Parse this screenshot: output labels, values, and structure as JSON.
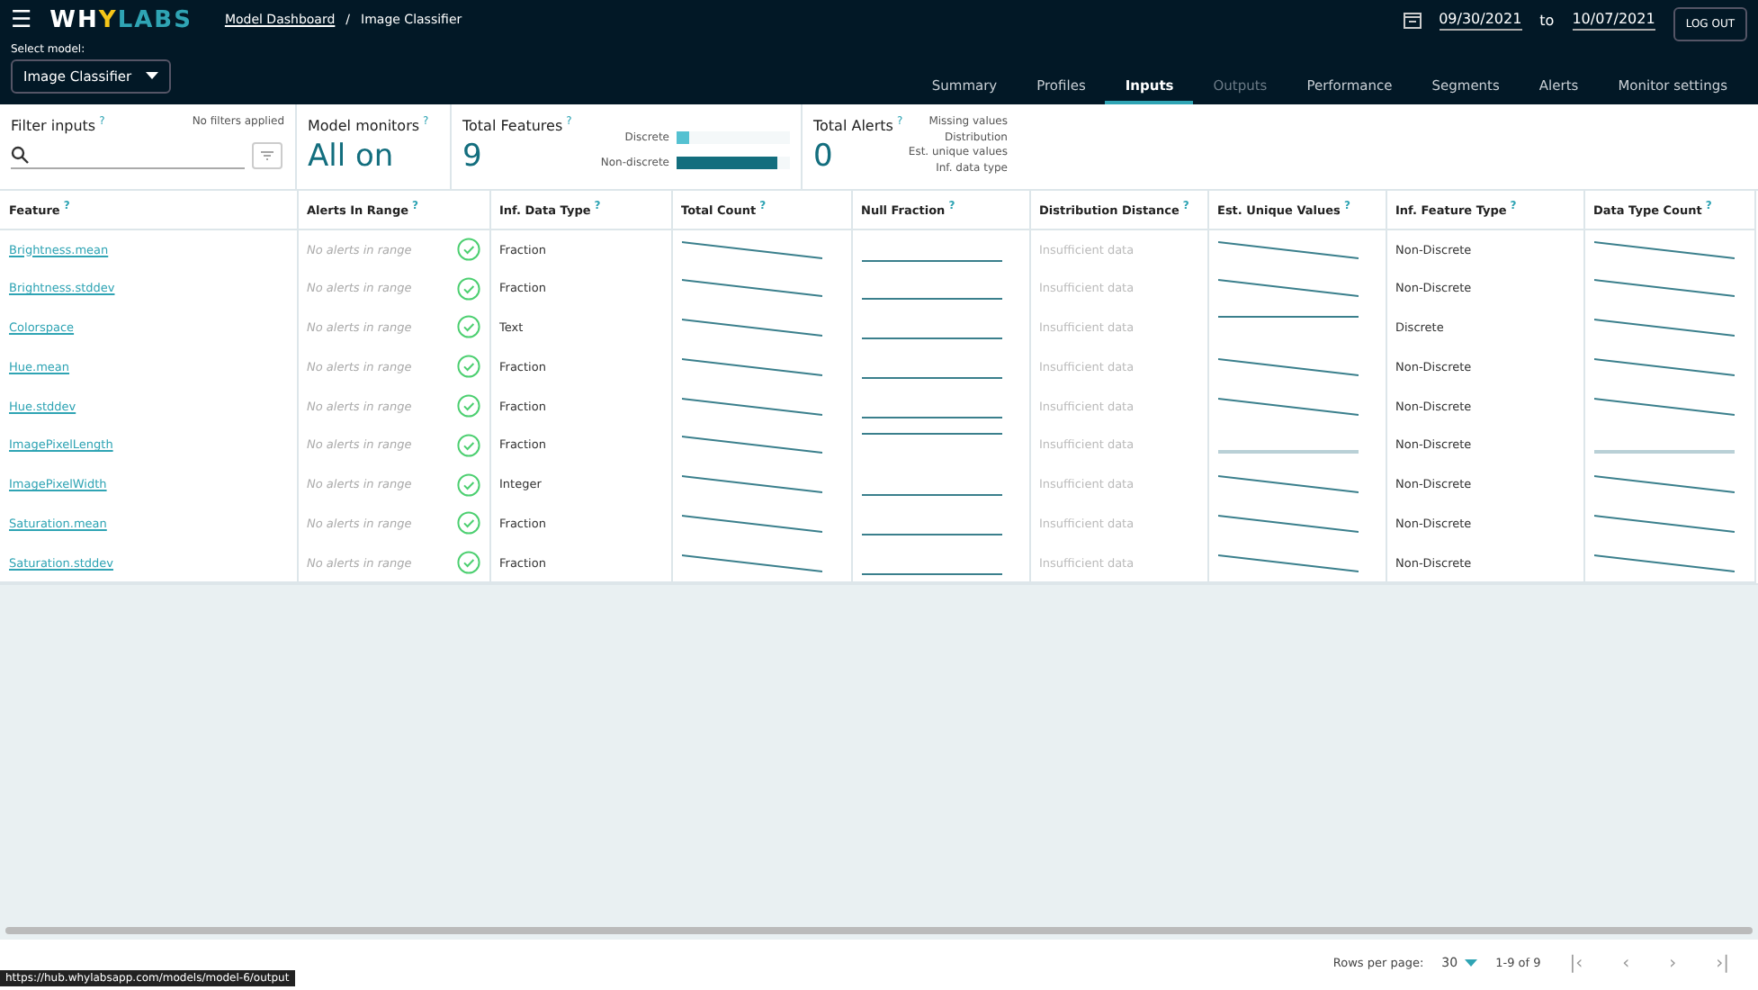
{
  "header": {
    "menu": "☰",
    "logo_parts": [
      {
        "text": "WH",
        "color": "#ffffff"
      },
      {
        "text": "Y",
        "color": "#f5c518"
      },
      {
        "text": "LABS",
        "color": "#2fa4b4"
      }
    ],
    "breadcrumb": {
      "link": "Model Dashboard",
      "separator": "/",
      "current": "Image Classifier"
    },
    "model_select": {
      "label": "Select model:",
      "value": "Image Classifier"
    },
    "date_range": {
      "from": "09/30/2021",
      "joiner": "to",
      "to": "10/07/2021"
    },
    "logout": "LOG OUT",
    "tabs": [
      {
        "label": "Summary",
        "selected": false,
        "disabled": false
      },
      {
        "label": "Profiles",
        "selected": false,
        "disabled": false
      },
      {
        "label": "Inputs",
        "selected": true,
        "disabled": false
      },
      {
        "label": "Outputs",
        "selected": false,
        "disabled": true
      },
      {
        "label": "Performance",
        "selected": false,
        "disabled": false
      },
      {
        "label": "Segments",
        "selected": false,
        "disabled": false
      },
      {
        "label": "Alerts",
        "selected": false,
        "disabled": false
      },
      {
        "label": "Monitor settings",
        "selected": false,
        "disabled": false
      }
    ]
  },
  "summary": {
    "filter": {
      "title": "Filter inputs",
      "help": "?",
      "status": "No filters applied"
    },
    "monitors": {
      "title": "Model monitors",
      "help": "?",
      "value": "All on"
    },
    "features": {
      "title": "Total Features",
      "help": "?",
      "value": "9",
      "bars": [
        {
          "label": "Discrete",
          "level": 0.11
        },
        {
          "label": "Non-discrete",
          "level": 0.89
        }
      ]
    },
    "alerts": {
      "title": "Total Alerts",
      "help": "?",
      "value": "0",
      "types": [
        "Missing values",
        "Distribution",
        "Est. unique values",
        "Inf. data type"
      ]
    }
  },
  "table": {
    "columns": [
      {
        "label": "Feature",
        "help": "?"
      },
      {
        "label": "Alerts In Range",
        "help": "?"
      },
      {
        "label": "Inf. Data Type",
        "help": "?"
      },
      {
        "label": "Total Count",
        "help": "?"
      },
      {
        "label": "Null Fraction",
        "help": "?"
      },
      {
        "label": "Distribution Distance",
        "help": "?"
      },
      {
        "label": "Est. Unique Values",
        "help": "?"
      },
      {
        "label": "Inf. Feature Type",
        "help": "?"
      },
      {
        "label": "Data Type Count",
        "help": "?"
      }
    ],
    "rows": [
      {
        "feature": "Brightness.mean",
        "alerts": "No alerts in range",
        "data_type": "Fraction",
        "total_count": {
          "kind": "decline"
        },
        "null_fraction": {
          "kind": "flat"
        },
        "distance": "Insufficient data",
        "unique": {
          "kind": "decline"
        },
        "feature_type": "Non-Discrete",
        "type_count": {
          "kind": "decline"
        }
      },
      {
        "feature": "Brightness.stddev",
        "alerts": "No alerts in range",
        "data_type": "Fraction",
        "total_count": {
          "kind": "decline"
        },
        "null_fraction": {
          "kind": "flat"
        },
        "distance": "Insufficient data",
        "unique": {
          "kind": "decline"
        },
        "feature_type": "Non-Discrete",
        "type_count": {
          "kind": "decline"
        }
      },
      {
        "feature": "Colorspace",
        "alerts": "No alerts in range",
        "data_type": "Text",
        "total_count": {
          "kind": "decline"
        },
        "null_fraction": {
          "kind": "flat"
        },
        "distance": "Insufficient data",
        "unique": {
          "kind": "high"
        },
        "feature_type": "Discrete",
        "type_count": {
          "kind": "decline"
        }
      },
      {
        "feature": "Hue.mean",
        "alerts": "No alerts in range",
        "data_type": "Fraction",
        "total_count": {
          "kind": "decline"
        },
        "null_fraction": {
          "kind": "flat"
        },
        "distance": "Insufficient data",
        "unique": {
          "kind": "decline"
        },
        "feature_type": "Non-Discrete",
        "type_count": {
          "kind": "decline"
        }
      },
      {
        "feature": "Hue.stddev",
        "alerts": "No alerts in range",
        "data_type": "Fraction",
        "total_count": {
          "kind": "decline"
        },
        "null_fraction": {
          "kind": "flat"
        },
        "distance": "Insufficient data",
        "unique": {
          "kind": "decline"
        },
        "feature_type": "Non-Discrete",
        "type_count": {
          "kind": "decline"
        }
      },
      {
        "feature": "ImagePixelLength",
        "alerts": "No alerts in range",
        "data_type": "Fraction",
        "total_count": {
          "kind": "decline"
        },
        "null_fraction": {
          "kind": "high"
        },
        "distance": "Insufficient data",
        "unique": {
          "kind": "light"
        },
        "feature_type": "Non-Discrete",
        "type_count": {
          "kind": "light"
        }
      },
      {
        "feature": "ImagePixelWidth",
        "alerts": "No alerts in range",
        "data_type": "Integer",
        "total_count": {
          "kind": "decline"
        },
        "null_fraction": {
          "kind": "flat"
        },
        "distance": "Insufficient data",
        "unique": {
          "kind": "decline"
        },
        "feature_type": "Non-Discrete",
        "type_count": {
          "kind": "decline"
        }
      },
      {
        "feature": "Saturation.mean",
        "alerts": "No alerts in range",
        "data_type": "Fraction",
        "total_count": {
          "kind": "decline"
        },
        "null_fraction": {
          "kind": "flat"
        },
        "distance": "Insufficient data",
        "unique": {
          "kind": "decline"
        },
        "feature_type": "Non-Discrete",
        "type_count": {
          "kind": "decline"
        }
      },
      {
        "feature": "Saturation.stddev",
        "alerts": "No alerts in range",
        "data_type": "Fraction",
        "total_count": {
          "kind": "decline"
        },
        "null_fraction": {
          "kind": "flat"
        },
        "distance": "Insufficient data",
        "unique": {
          "kind": "decline"
        },
        "feature_type": "Non-Discrete",
        "type_count": {
          "kind": "decline"
        }
      }
    ]
  },
  "pagination": {
    "rows_label": "Rows per page:",
    "rows_value": "30",
    "range": "1-9 of 9",
    "first": "|‹",
    "prev": "‹",
    "next": "›",
    "last": "›|"
  },
  "status_bar": "https://hub.whylabsapp.com/models/model-6/output"
}
